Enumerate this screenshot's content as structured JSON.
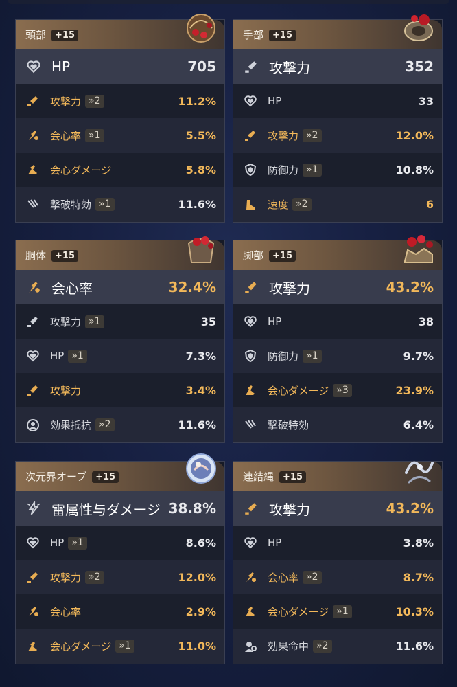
{
  "relics": [
    {
      "slot": "頭部",
      "level": "+15",
      "icon": "helmet-relic-icon",
      "main": {
        "name": "HP",
        "value": "705",
        "icon": "heart-icon",
        "gold": false
      },
      "subs": [
        {
          "name": "攻撃力",
          "step": "»2",
          "value": "11.2%",
          "icon": "sword-icon",
          "gold": true
        },
        {
          "name": "会心率",
          "step": "»1",
          "value": "5.5%",
          "icon": "crit-rate-icon",
          "gold": true
        },
        {
          "name": "会心ダメージ",
          "step": "",
          "value": "5.8%",
          "icon": "crit-dmg-icon",
          "gold": true
        },
        {
          "name": "撃破特効",
          "step": "»1",
          "value": "11.6%",
          "icon": "break-icon",
          "gold": false
        }
      ]
    },
    {
      "slot": "手部",
      "level": "+15",
      "icon": "gauntlet-relic-icon",
      "main": {
        "name": "攻撃力",
        "value": "352",
        "icon": "sword-icon",
        "gold": false
      },
      "subs": [
        {
          "name": "HP",
          "step": "",
          "value": "33",
          "icon": "heart-icon",
          "gold": false
        },
        {
          "name": "攻撃力",
          "step": "»2",
          "value": "12.0%",
          "icon": "sword-icon",
          "gold": true
        },
        {
          "name": "防御力",
          "step": "»1",
          "value": "10.8%",
          "icon": "shield-icon",
          "gold": false
        },
        {
          "name": "速度",
          "step": "»2",
          "value": "6",
          "icon": "boot-icon",
          "gold": true
        }
      ]
    },
    {
      "slot": "胴体",
      "level": "+15",
      "icon": "armor-relic-icon",
      "main": {
        "name": "会心率",
        "value": "32.4%",
        "icon": "crit-rate-icon",
        "gold": true
      },
      "subs": [
        {
          "name": "攻撃力",
          "step": "»1",
          "value": "35",
          "icon": "sword-icon",
          "gold": false
        },
        {
          "name": "HP",
          "step": "»1",
          "value": "7.3%",
          "icon": "heart-icon",
          "gold": false
        },
        {
          "name": "攻撃力",
          "step": "",
          "value": "3.4%",
          "icon": "sword-icon",
          "gold": true
        },
        {
          "name": "効果抵抗",
          "step": "»2",
          "value": "11.6%",
          "icon": "effect-res-icon",
          "gold": false
        }
      ]
    },
    {
      "slot": "脚部",
      "level": "+15",
      "icon": "boots-relic-icon",
      "main": {
        "name": "攻撃力",
        "value": "43.2%",
        "icon": "sword-icon",
        "gold": true
      },
      "subs": [
        {
          "name": "HP",
          "step": "",
          "value": "38",
          "icon": "heart-icon",
          "gold": false
        },
        {
          "name": "防御力",
          "step": "»1",
          "value": "9.7%",
          "icon": "shield-icon",
          "gold": false
        },
        {
          "name": "会心ダメージ",
          "step": "»3",
          "value": "23.9%",
          "icon": "crit-dmg-icon",
          "gold": true
        },
        {
          "name": "撃破特効",
          "step": "",
          "value": "6.4%",
          "icon": "break-icon",
          "gold": false
        }
      ]
    },
    {
      "slot": "次元界オーブ",
      "level": "+15",
      "icon": "orb-relic-icon",
      "main": {
        "name": "雷属性与ダメージ",
        "value": "38.8%",
        "icon": "lightning-icon",
        "gold": false
      },
      "subs": [
        {
          "name": "HP",
          "step": "»1",
          "value": "8.6%",
          "icon": "heart-icon",
          "gold": false
        },
        {
          "name": "攻撃力",
          "step": "»2",
          "value": "12.0%",
          "icon": "sword-icon",
          "gold": true
        },
        {
          "name": "会心率",
          "step": "",
          "value": "2.9%",
          "icon": "crit-rate-icon",
          "gold": true
        },
        {
          "name": "会心ダメージ",
          "step": "»1",
          "value": "11.0%",
          "icon": "crit-dmg-icon",
          "gold": true
        }
      ]
    },
    {
      "slot": "連結縄",
      "level": "+15",
      "icon": "rope-relic-icon",
      "main": {
        "name": "攻撃力",
        "value": "43.2%",
        "icon": "sword-icon",
        "gold": true
      },
      "subs": [
        {
          "name": "HP",
          "step": "",
          "value": "3.8%",
          "icon": "heart-icon",
          "gold": false
        },
        {
          "name": "会心率",
          "step": "»2",
          "value": "8.7%",
          "icon": "crit-rate-icon",
          "gold": true
        },
        {
          "name": "会心ダメージ",
          "step": "»1",
          "value": "10.3%",
          "icon": "crit-dmg-icon",
          "gold": true
        },
        {
          "name": "効果命中",
          "step": "»2",
          "value": "11.6%",
          "icon": "effect-hit-icon",
          "gold": false
        }
      ]
    }
  ]
}
